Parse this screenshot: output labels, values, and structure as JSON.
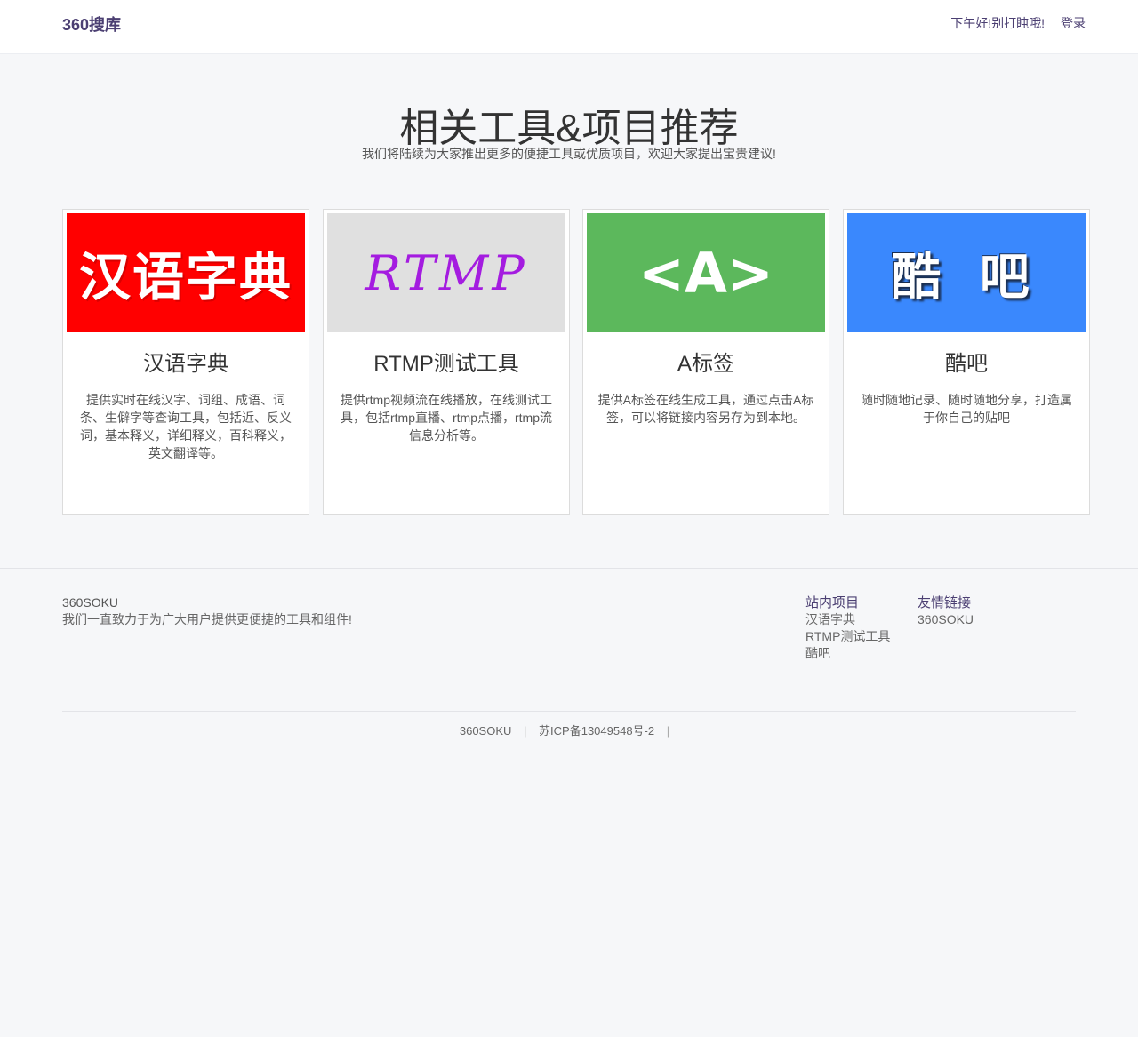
{
  "nav": {
    "brand": "360搜库",
    "greeting": "下午好!别打盹哦!",
    "login": "登录"
  },
  "section": {
    "title": "相关工具&项目推荐",
    "subtitle": "我们将陆续为大家推出更多的便捷工具或优质项目，欢迎大家提出宝贵建议!"
  },
  "cards": [
    {
      "image_text": "汉语字典",
      "image_bg": "#ff0000",
      "title": "汉语字典",
      "desc": "提供实时在线汉字、词组、成语、词条、生僻字等查询工具，包括近、反义词，基本释义，详细释义，百科释义，英文翻译等。"
    },
    {
      "image_text": "RTMP",
      "image_bg": "#e0e0e0",
      "title": "RTMP测试工具",
      "desc": "提供rtmp视频流在线播放，在线测试工具，包括rtmp直播、rtmp点播，rtmp流信息分析等。"
    },
    {
      "image_text": "<A>",
      "image_bg": "#5cb85c",
      "title": "A标签",
      "desc": "提供A标签在线生成工具，通过点击A标签，可以将链接内容另存为到本地。"
    },
    {
      "image_text": "酷 吧",
      "image_bg": "#3a88fd",
      "title": "酷吧",
      "desc": "随时随地记录、随时随地分享，打造属于你自己的贴吧"
    }
  ],
  "footer": {
    "brand": "360SOKU",
    "slogan": "我们一直致力于为广大用户提供更便捷的工具和组件!",
    "projects": {
      "heading": "站内项目",
      "links": [
        "汉语字典",
        "RTMP测试工具",
        "酷吧"
      ]
    },
    "friends": {
      "heading": "友情链接",
      "links": [
        "360SOKU"
      ]
    },
    "copyright": {
      "name": "360SOKU",
      "sep": "|",
      "icp": "苏ICP备13049548号-2"
    }
  }
}
